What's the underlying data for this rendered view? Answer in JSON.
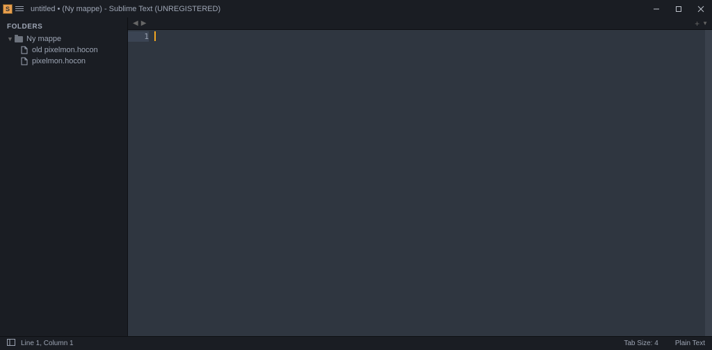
{
  "window": {
    "title": "untitled • (Ny mappe) - Sublime Text (UNREGISTERED)"
  },
  "sidebar": {
    "heading": "FOLDERS",
    "tree": {
      "folder": {
        "name": "Ny mappe"
      },
      "files": [
        {
          "name": "old pixelmon.hocon"
        },
        {
          "name": "pixelmon.hocon"
        }
      ]
    }
  },
  "editor": {
    "line_numbers": [
      "1"
    ]
  },
  "statusbar": {
    "position": "Line 1, Column 1",
    "tab_size": "Tab Size: 4",
    "syntax": "Plain Text"
  }
}
